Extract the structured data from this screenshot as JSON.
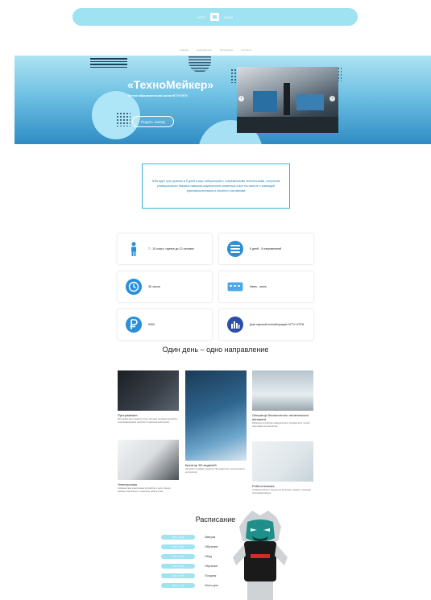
{
  "header": {
    "logo_left": "НГТУ",
    "logo_right": "НЭТИ",
    "brand_color": "#9fe3f2"
  },
  "subnav": {
    "items": [
      "Главная",
      "Направления",
      "Расписание",
      "Контакты"
    ]
  },
  "hero": {
    "title": "«ТехноМейкер»",
    "subtitle": "Летняя образовательная школа НГТУ НЭТИ",
    "cta_label": "Подать заявку",
    "prev_icon": "chevron-left-icon",
    "next_icon": "chevron-right-icon"
  },
  "intro": {
    "text": "Тебя ждет путь длиною в 5 дней в мир лабораторий с современными технологиями, получение универсальных базовых навыков современного инженера и все это вместе с командой единомышленников и опытного наставника"
  },
  "features": [
    {
      "icon": "person-icon",
      "text": "7 - 10 класс, группа до 12 человек",
      "color": "#2a8fd6"
    },
    {
      "icon": "list-icon",
      "text": "5 дней - 5 направлений",
      "color": "#2a8fd6"
    },
    {
      "icon": "clock-icon",
      "text": "36 часов",
      "color": "#2a8fd6"
    },
    {
      "icon": "calendar-icon",
      "text": "Июнь - июль",
      "color": "#4aa9e6"
    },
    {
      "icon": "ruble-icon",
      "text": "9900",
      "color": "#2a8fd6"
    },
    {
      "icon": "building-icon",
      "text": "Дом научной коллаборации НГТУ НЭТИ",
      "color": "#2b4fa8"
    }
  ],
  "directions_title": "Один день – одно направление",
  "directions": [
    {
      "name": "Программист",
      "desc": "Расскажем как создаются игры, обсудим основные принципы программирования на Python и напишем свой проект"
    },
    {
      "name": "Оператор беспилотного летательного аппарата",
      "desc": "Разберем устройство квадрокоптера, пройдем курс летной подготовки на симуляторе"
    },
    {
      "name": "Электроника",
      "desc": "Соберем свое электронное устройство с нуля, изучим базовые компоненты и принципы работы схем"
    },
    {
      "name": "Креатор 3D моделей",
      "desc": "Научимся создавать модели в 3D-редакторе и напечатаем их на принтере"
    },
    {
      "name": "Робототехника",
      "desc": "Соберем робота и научим его выполнять задачи с помощью программирования"
    }
  ],
  "schedule": {
    "title": "Расписание",
    "rows": [
      {
        "time": "09:00 - 10:00",
        "activity": "Завтрак"
      },
      {
        "time": "10:00 - 13:00",
        "activity": "Обучение"
      },
      {
        "time": "13:00 - 14:00",
        "activity": "Обед"
      },
      {
        "time": "14:00 - 16:00",
        "activity": "Обучение"
      },
      {
        "time": "16:00 - 16:30",
        "activity": "Полдник"
      },
      {
        "time": "16:30 - 17:00",
        "activity": "Итоги дня"
      }
    ]
  }
}
